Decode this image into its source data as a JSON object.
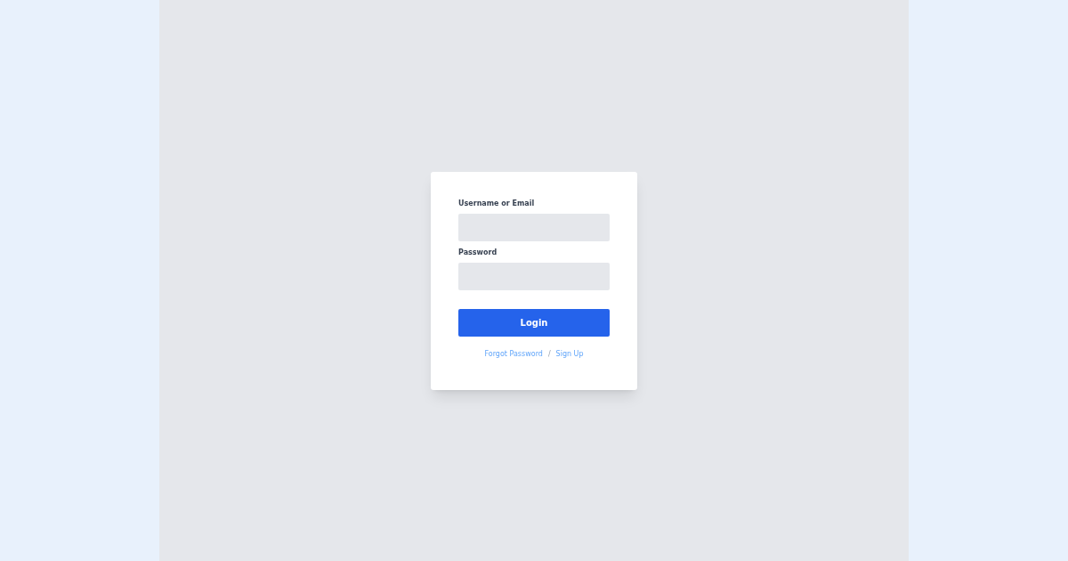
{
  "form": {
    "fields": [
      {
        "label": "Username or Email"
      },
      {
        "label": "Password"
      }
    ],
    "submit": "Login",
    "links": [
      {
        "kind": "link",
        "text": "Forgot Password"
      },
      {
        "kind": "separator",
        "text": "/"
      },
      {
        "kind": "link",
        "text": "Sign Up"
      }
    ]
  }
}
